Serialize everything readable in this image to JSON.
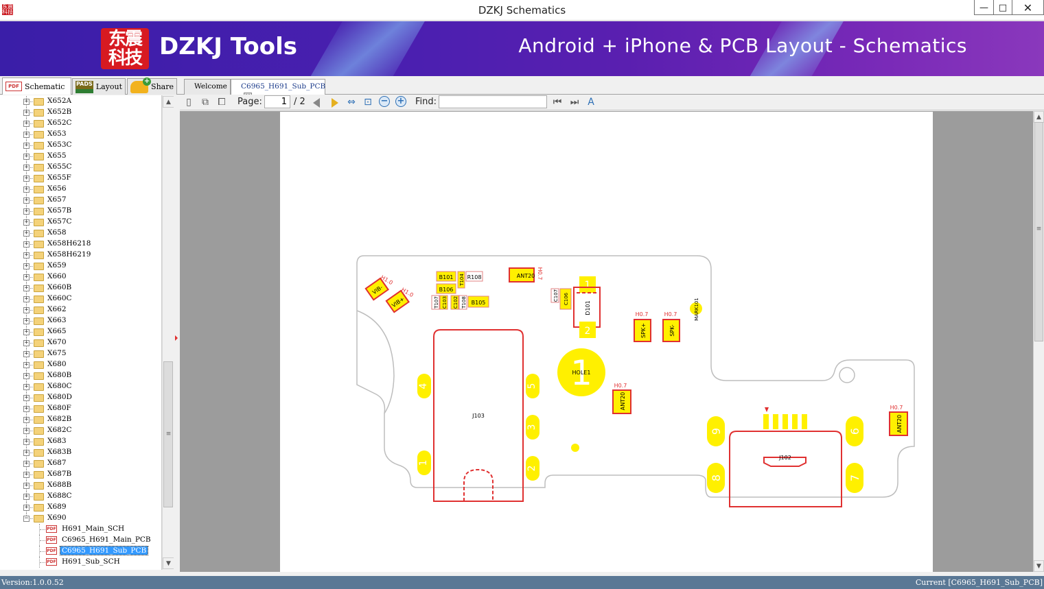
{
  "window": {
    "title": "DZKJ Schematics",
    "icon_text": "东震科技",
    "minimize_glyph": "—",
    "maximize_glyph": "□",
    "close_glyph": "✕"
  },
  "banner": {
    "logo_text": "东震科技",
    "brand": "DZKJ Tools",
    "tagline": "Android + iPhone & PCB Layout - Schematics"
  },
  "left_tabs": [
    {
      "label": "Schematic",
      "icon": "PDF",
      "active": true
    },
    {
      "label": "Layout",
      "icon": "PADS",
      "active": false
    },
    {
      "label": "Share",
      "icon": "share-cloud-icon",
      "active": false
    }
  ],
  "tree": {
    "folders": [
      "X652A",
      "X652B",
      "X652C",
      "X653",
      "X653C",
      "X655",
      "X655C",
      "X655F",
      "X656",
      "X657",
      "X657B",
      "X657C",
      "X658",
      "X658H6218",
      "X658H6219",
      "X659",
      "X660",
      "X660B",
      "X660C",
      "X662",
      "X663",
      "X665",
      "X670",
      "X675",
      "X680",
      "X680B",
      "X680C",
      "X680D",
      "X680F",
      "X682B",
      "X682C",
      "X683",
      "X683B",
      "X687",
      "X687B",
      "X688B",
      "X688C",
      "X689"
    ],
    "expanded_folder": "X690",
    "files": [
      {
        "label": "H691_Main_SCH",
        "selected": false
      },
      {
        "label": "C6965_H691_Main_PCB",
        "selected": false
      },
      {
        "label": "C6965_H691_Sub_PCB",
        "selected": true
      },
      {
        "label": "H691_Sub_SCH",
        "selected": false
      }
    ],
    "expand_glyph": "+",
    "collapse_glyph": "−",
    "file_icon_text": "PDF"
  },
  "doc_tabs": [
    {
      "label": "Welcome",
      "active": false
    },
    {
      "label": "C6965_H691_Sub_PCB",
      "active": true,
      "close_glyph": "✕"
    }
  ],
  "toolbar": {
    "page_label": "Page:",
    "page_current": "1",
    "page_total": "/ 2",
    "find_label": "Find:",
    "find_value": "",
    "zoom_out_glyph": "−",
    "zoom_in_glyph": "+"
  },
  "pcb": {
    "refs": {
      "b101": "B101",
      "r108": "R108",
      "t104": "T104",
      "b106": "B106",
      "t107": "T107",
      "c103": "C103",
      "c102": "C102",
      "t108": "T108",
      "b105": "B105",
      "c107": "C107",
      "c106": "C106",
      "d101": "D101",
      "pad1": "1",
      "pad2": "2",
      "ant201": "ANT20",
      "h07a": "H0.7",
      "vibm": "VIB-",
      "vibp": "VIB+",
      "h10a": "H1.0",
      "h10b": "H1.0",
      "spkp": "SPK+",
      "spkm": "SPK-",
      "h07b": "H0.7",
      "h07c": "H0.7",
      "mark": "MARK101",
      "hole": "HOLE1",
      "hole_num": "1",
      "j103": "J103",
      "p4": "4",
      "p5": "5",
      "p3": "3",
      "p1": "1",
      "p2": "2",
      "ant202": "ANT20",
      "h07d": "H0.7",
      "ant203": "ANT20",
      "h07e": "H0.7",
      "j102": "J102",
      "p6": "6",
      "p9": "9",
      "p8": "8",
      "p7": "7"
    }
  },
  "status": {
    "version": "Version:1.0.0.52",
    "current": "Current [C6965_H691_Sub_PCB]"
  }
}
